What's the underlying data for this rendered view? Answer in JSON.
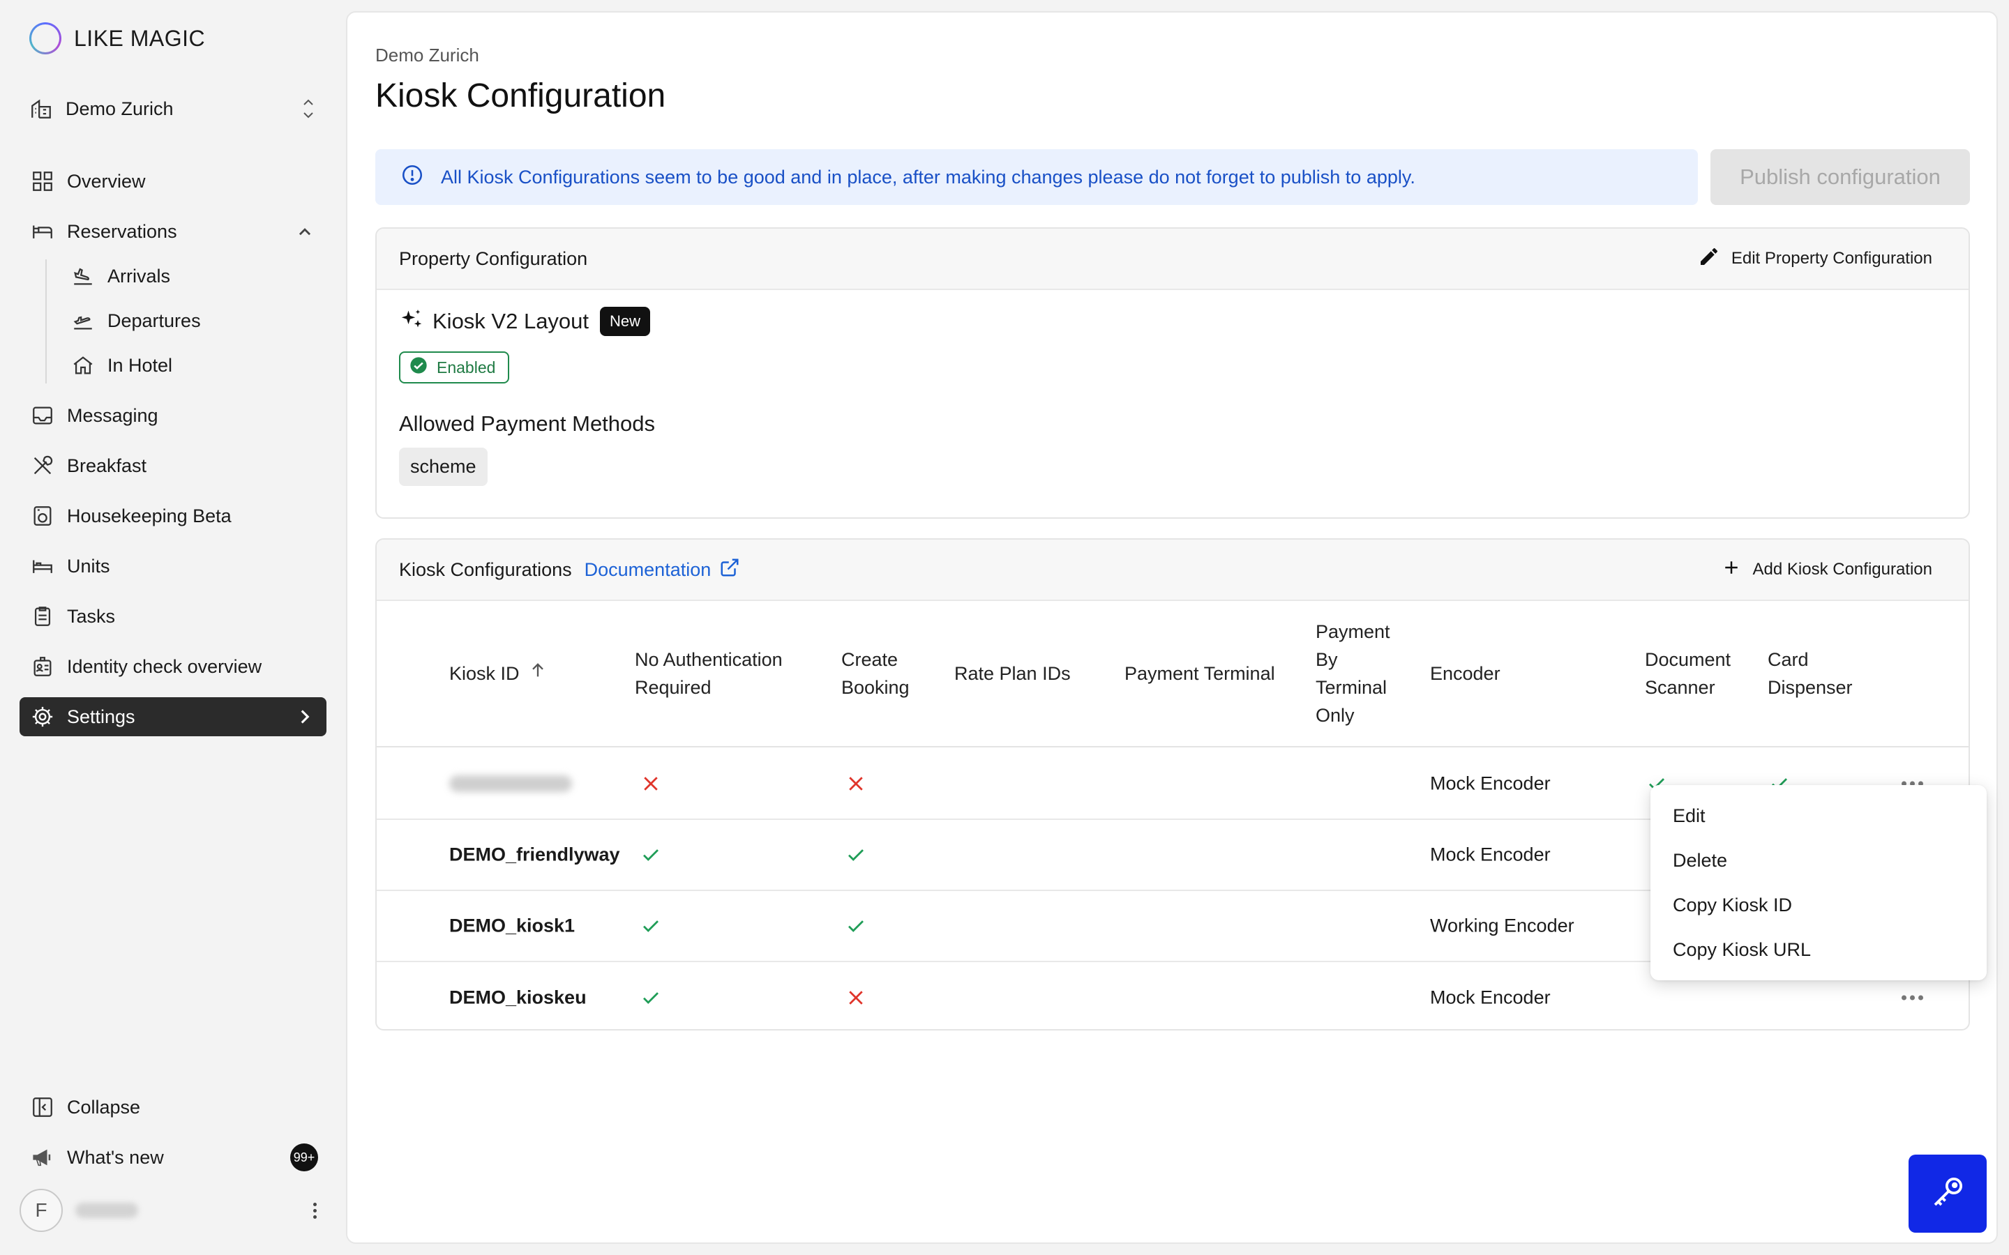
{
  "app": {
    "logo_text": "LIKE MAGIC",
    "accent": "#1128e6"
  },
  "sidebar": {
    "property": "Demo Zurich",
    "items": [
      {
        "label": "Overview"
      },
      {
        "label": "Reservations"
      },
      {
        "label": "Arrivals"
      },
      {
        "label": "Departures"
      },
      {
        "label": "In Hotel"
      },
      {
        "label": "Messaging"
      },
      {
        "label": "Breakfast"
      },
      {
        "label": "Housekeeping Beta"
      },
      {
        "label": "Units"
      },
      {
        "label": "Tasks"
      },
      {
        "label": "Identity check overview"
      },
      {
        "label": "Settings"
      }
    ],
    "collapse_label": "Collapse",
    "whats_new_label": "What's new",
    "whats_new_badge": "99+",
    "user_initial": "F"
  },
  "header": {
    "breadcrumb": "Demo Zurich",
    "title": "Kiosk Configuration"
  },
  "banner": {
    "text": "All Kiosk Configurations seem to be good and in place, after making changes please do not forget to publish to apply.",
    "publish_label": "Publish configuration"
  },
  "property_config": {
    "title": "Property Configuration",
    "edit_label": "Edit Property Configuration",
    "layout_title": "Kiosk V2 Layout",
    "new_badge": "New",
    "status": "Enabled",
    "payment_title": "Allowed Payment Methods",
    "payment_methods": [
      "scheme"
    ]
  },
  "kiosk_config": {
    "title": "Kiosk Configurations",
    "doc_label": "Documentation",
    "add_label": "Add Kiosk Configuration",
    "columns": {
      "kiosk_id": "Kiosk ID",
      "no_auth": "No Authentication Required",
      "create_booking": "Create Booking",
      "rate_plan": "Rate Plan IDs",
      "payment_terminal": "Payment Terminal",
      "payment_by_terminal": "Payment By Terminal Only",
      "encoder": "Encoder",
      "document_scanner": "Document Scanner",
      "card_dispenser": "Card Dispenser"
    },
    "rows": [
      {
        "id": "",
        "no_auth": false,
        "create_booking": false,
        "encoder": "Mock Encoder",
        "document_scanner": true,
        "card_dispenser": true
      },
      {
        "id": "DEMO_friendlyway",
        "no_auth": true,
        "create_booking": true,
        "encoder": "Mock Encoder"
      },
      {
        "id": "DEMO_kiosk1",
        "no_auth": true,
        "create_booking": true,
        "encoder": "Working Encoder"
      },
      {
        "id": "DEMO_kioskeu",
        "no_auth": true,
        "create_booking": false,
        "encoder": "Mock Encoder"
      }
    ]
  },
  "row_menu": {
    "items": [
      "Edit",
      "Delete",
      "Copy Kiosk ID",
      "Copy Kiosk URL"
    ]
  }
}
